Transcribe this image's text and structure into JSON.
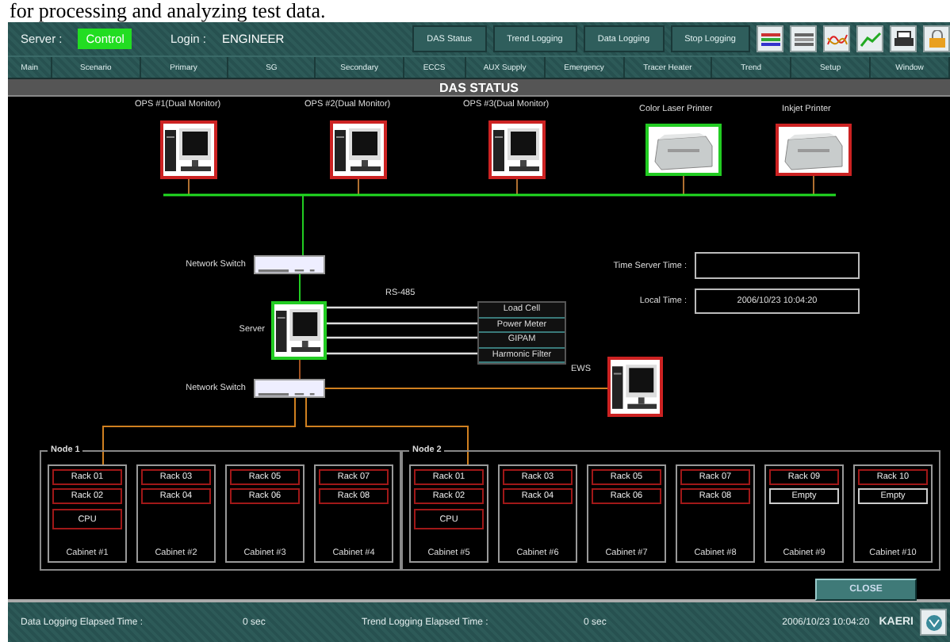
{
  "caption": "for processing and analyzing test data.",
  "top_bar": {
    "server_label": "Server :",
    "server_mode": "Control",
    "login_label": "Login :",
    "login_user": "ENGINEER",
    "buttons": [
      "DAS Status",
      "Trend Logging",
      "Data Logging",
      "Stop Logging"
    ]
  },
  "menu": [
    "Main",
    "Scenario",
    "Primary",
    "SG",
    "Secondary",
    "ECCS",
    "AUX Supply",
    "Emergency",
    "Tracer Heater",
    "Trend",
    "Setup",
    "Window"
  ],
  "title": "DAS STATUS",
  "workstations": [
    {
      "label": "OPS #1(Dual Monitor)",
      "color": "#cc2222"
    },
    {
      "label": "OPS #2(Dual Monitor)",
      "color": "#cc2222"
    },
    {
      "label": "OPS #3(Dual Monitor)",
      "color": "#cc2222"
    }
  ],
  "printers": [
    {
      "label": "Color Laser Printer",
      "color": "#22cc22"
    },
    {
      "label": "Inkjet Printer",
      "color": "#cc2222"
    }
  ],
  "switches": [
    "Network Switch",
    "Network Switch"
  ],
  "server": {
    "label": "Server",
    "color": "#22cc22"
  },
  "ews": {
    "label": "EWS",
    "color": "#cc2222"
  },
  "bus_label": "RS-485",
  "serial_devices": [
    "Load Cell",
    "Power Meter",
    "GIPAM",
    "Harmonic Filter"
  ],
  "time_server": {
    "label": "Time Server Time :"
  },
  "local_time": {
    "label": "Local Time :",
    "value": "2006/10/23 10:04:20"
  },
  "nodes": [
    {
      "label": "Node 1",
      "cabinets": [
        {
          "label": "Cabinet #1",
          "racks": [
            {
              "label": "Rack 01",
              "kind": "rack"
            },
            {
              "label": "Rack 02",
              "kind": "rack"
            }
          ],
          "cpu": "CPU"
        },
        {
          "label": "Cabinet #2",
          "racks": [
            {
              "label": "Rack 03",
              "kind": "rack"
            },
            {
              "label": "Rack 04",
              "kind": "rack"
            }
          ]
        },
        {
          "label": "Cabinet #3",
          "racks": [
            {
              "label": "Rack 05",
              "kind": "rack"
            },
            {
              "label": "Rack 06",
              "kind": "rack"
            }
          ]
        },
        {
          "label": "Cabinet #4",
          "racks": [
            {
              "label": "Rack 07",
              "kind": "rack"
            },
            {
              "label": "Rack 08",
              "kind": "rack"
            }
          ]
        }
      ]
    },
    {
      "label": "Node 2",
      "cabinets": [
        {
          "label": "Cabinet #5",
          "racks": [
            {
              "label": "Rack 01",
              "kind": "rack"
            },
            {
              "label": "Rack 02",
              "kind": "rack"
            }
          ],
          "cpu": "CPU"
        },
        {
          "label": "Cabinet #6",
          "racks": [
            {
              "label": "Rack 03",
              "kind": "rack"
            },
            {
              "label": "Rack 04",
              "kind": "rack"
            }
          ]
        },
        {
          "label": "Cabinet #7",
          "racks": [
            {
              "label": "Rack 05",
              "kind": "rack"
            },
            {
              "label": "Rack 06",
              "kind": "rack"
            }
          ]
        },
        {
          "label": "Cabinet #8",
          "racks": [
            {
              "label": "Rack 07",
              "kind": "rack"
            },
            {
              "label": "Rack 08",
              "kind": "rack"
            }
          ]
        },
        {
          "label": "Cabinet #9",
          "racks": [
            {
              "label": "Rack 09",
              "kind": "rack"
            },
            {
              "label": "Empty",
              "kind": "empty"
            }
          ]
        },
        {
          "label": "Cabinet #10",
          "racks": [
            {
              "label": "Rack 10",
              "kind": "rack"
            },
            {
              "label": "Empty",
              "kind": "empty"
            }
          ]
        }
      ]
    }
  ],
  "close_button": "CLOSE",
  "status_bar": {
    "data_label": "Data Logging Elapsed Time :",
    "data_value": "0 sec",
    "trend_label": "Trend Logging Elapsed Time :",
    "trend_value": "0 sec",
    "clock": "2006/10/23 10:04:20",
    "brand": "KAERI"
  }
}
